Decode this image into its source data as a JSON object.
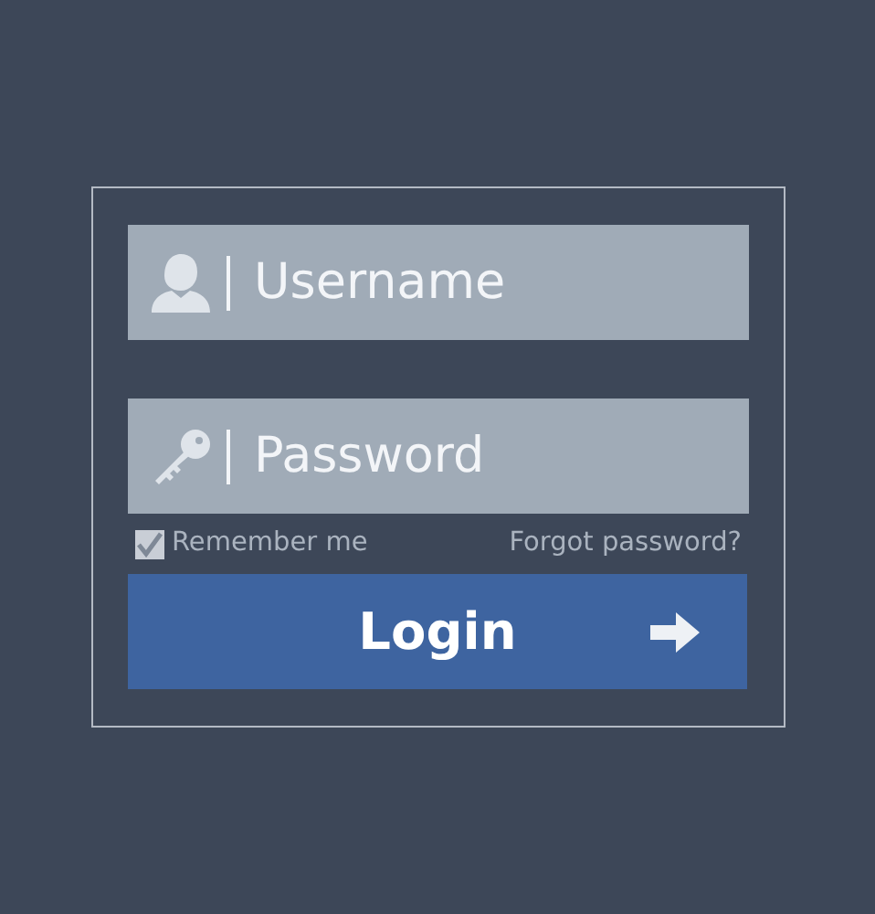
{
  "fields": [
    {
      "kind": "user",
      "placeholder": "Username"
    },
    {
      "kind": "key",
      "placeholder": "Password"
    }
  ],
  "remember": {
    "label": "Remember me",
    "checked": true
  },
  "forgot_link": "Forgot password?",
  "login_button": {
    "label": "Login"
  }
}
